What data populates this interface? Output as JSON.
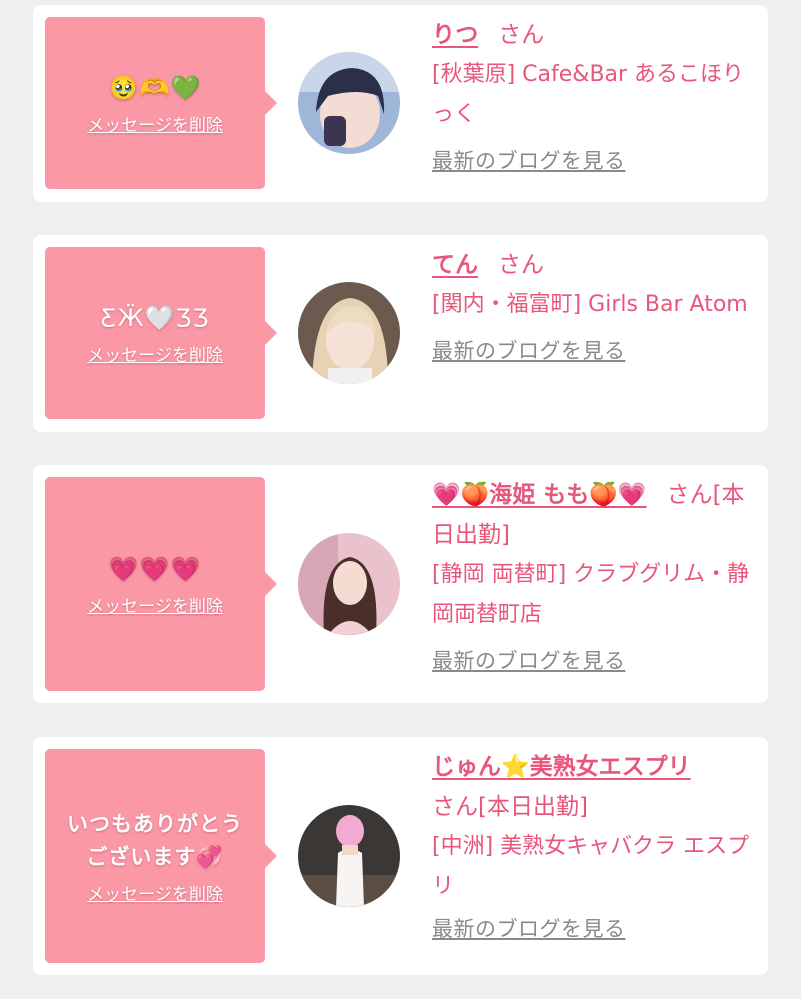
{
  "colors": {
    "page_bg": "#efefef",
    "card_bg": "#ffffff",
    "message_bg": "#fa98a6",
    "accent_pink": "#e8567a",
    "link_gray": "#8a8a8a"
  },
  "messages": [
    {
      "message_text": "🥹🫶💚",
      "delete_label": "メッセージを削除",
      "name": "りつ",
      "honorific": "さん",
      "shop": "[秋葉原] Cafe&Bar あるこほりっく",
      "blog_link": "最新のブログを見る",
      "avatar_icon": "profile-photo-dark-hair"
    },
    {
      "message_text": "ƸӜ🤍ƷƷ",
      "delete_label": "メッセージを削除",
      "name": "てん",
      "honorific": "さん",
      "shop": "[関内・福富町] Girls Bar Atom",
      "blog_link": "最新のブログを見る",
      "avatar_icon": "profile-photo-blonde-hair"
    },
    {
      "message_text": "💗💗💗",
      "delete_label": "メッセージを削除",
      "name": "💗🍑海姫 もも🍑💗",
      "honorific": "さん",
      "status": "[本日出勤]",
      "shop": "[静岡 両替町] クラブグリム・静岡両替町店",
      "blog_link": "最新のブログを見る",
      "avatar_icon": "profile-photo-long-hair"
    },
    {
      "message_text": "いつもありがとうございます💞",
      "delete_label": "メッセージを削除",
      "name": "じゅん⭐美熟女エスプリ",
      "honorific": "さん",
      "status": "[本日出勤]",
      "shop": "[中洲] 美熟女キャバクラ エスプリ",
      "blog_link": "最新のブログを見る",
      "avatar_icon": "profile-photo-white-dress"
    }
  ]
}
